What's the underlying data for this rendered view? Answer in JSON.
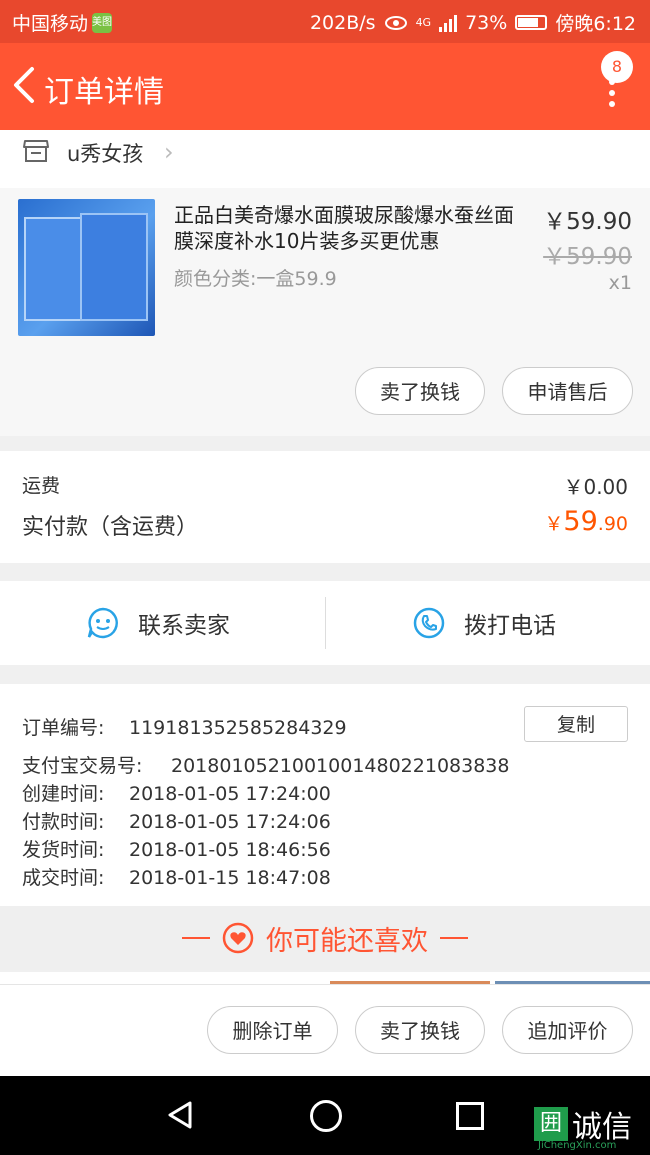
{
  "status_bar": {
    "carrier": "中国移动",
    "app_badge": "美图",
    "net_speed": "202B/s",
    "network": "4G",
    "battery_pct": "73%",
    "time": "傍晚6:12"
  },
  "app_bar": {
    "title": "订单详情",
    "notification_count": "8"
  },
  "shop": {
    "name": "u秀女孩"
  },
  "item": {
    "title": "正品白美奇爆水面膜玻尿酸爆水蚕丝面膜深度补水10片装多买更优惠",
    "spec": "颜色分类:一盒59.9",
    "price": "￥59.90",
    "original_price": "￥59.90",
    "quantity": "x1",
    "buttons": [
      "卖了换钱",
      "申请售后"
    ]
  },
  "fees": {
    "shipping_label": "运费",
    "shipping_value": "￥0.00",
    "paid_label": "实付款（含运费）",
    "paid_currency": "￥",
    "paid_int": "59",
    "paid_dec": ".90"
  },
  "contact": {
    "seller_label": "联系卖家",
    "phone_label": "拨打电话"
  },
  "order_info": {
    "copy_label": "复制",
    "rows": [
      {
        "key": "订单编号:",
        "value": "119181352585284329"
      },
      {
        "key": "支付宝交易号:",
        "value": "2018010521001001480221083838"
      },
      {
        "key": "创建时间:",
        "value": "2018-01-05 17:24:00"
      },
      {
        "key": "付款时间:",
        "value": "2018-01-05 17:24:06"
      },
      {
        "key": "发货时间:",
        "value": "2018-01-05 18:46:56"
      },
      {
        "key": "成交时间:",
        "value": "2018-01-15 18:47:08"
      }
    ]
  },
  "recommend": {
    "title": "你可能还喜欢"
  },
  "actions": [
    "删除订单",
    "卖了换钱",
    "追加评价"
  ],
  "watermark": {
    "text": "诚信",
    "sub": "JiChengXin.com"
  },
  "colors": {
    "accent": "#ff5533",
    "price_highlight": "#ff5500"
  }
}
